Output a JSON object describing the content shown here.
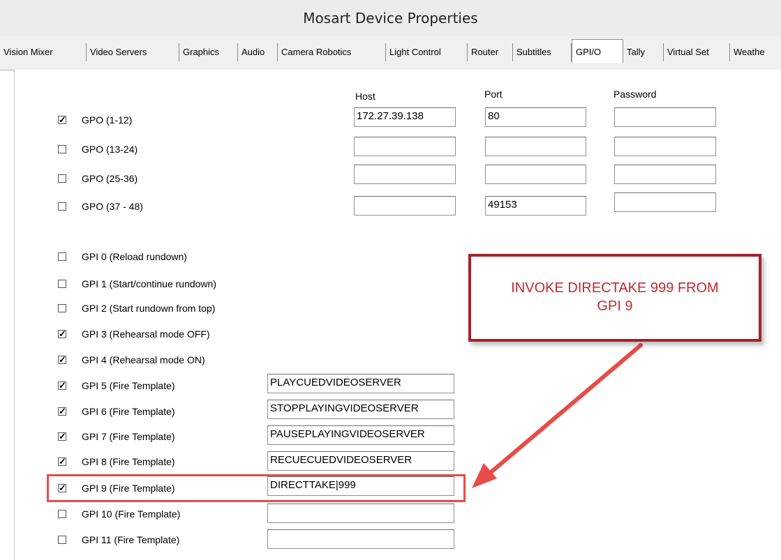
{
  "window": {
    "title": "Mosart Device Properties"
  },
  "tabs": [
    {
      "label": "Vision Mixer"
    },
    {
      "label": "Video Servers"
    },
    {
      "label": "Graphics"
    },
    {
      "label": "Audio"
    },
    {
      "label": "Camera Robotics"
    },
    {
      "label": "Light Control"
    },
    {
      "label": "Router"
    },
    {
      "label": "Subtitles"
    },
    {
      "label": "GPI/O",
      "active": true
    },
    {
      "label": "Tally"
    },
    {
      "label": "Virtual Set"
    },
    {
      "label": "Weathe"
    }
  ],
  "gpo": {
    "headers": {
      "host": "Host",
      "port": "Port",
      "password": "Password"
    },
    "rows": [
      {
        "label": "GPO (1-12)",
        "checked": true,
        "check_glyph": "✓",
        "host": "172.27.39.138",
        "port": "80",
        "password": ""
      },
      {
        "label": "GPO (13-24)",
        "checked": false,
        "check_glyph": "",
        "host": "",
        "port": "",
        "password": ""
      },
      {
        "label": "GPO (25-36)",
        "checked": false,
        "check_glyph": "",
        "host": "",
        "port": "",
        "password": ""
      },
      {
        "label": "GPO (37 - 48)",
        "checked": false,
        "check_glyph": "",
        "host": "",
        "port": "49153",
        "password": ""
      }
    ]
  },
  "gpi": {
    "rows": [
      {
        "label": "GPI 0  (Reload rundown)",
        "checked": false,
        "check_glyph": ""
      },
      {
        "label": "GPI 1  (Start/continue rundown)",
        "checked": false,
        "check_glyph": ""
      },
      {
        "label": "GPI 2  (Start rundown from top)",
        "checked": false,
        "check_glyph": ""
      },
      {
        "label": "GPI 3  (Rehearsal mode OFF)",
        "checked": true,
        "check_glyph": "✓"
      },
      {
        "label": "GPI 4  (Rehearsal mode ON)",
        "checked": true,
        "check_glyph": "✓"
      },
      {
        "label": "GPI 5 (Fire Template)",
        "checked": true,
        "check_glyph": "✓",
        "template": "PLAYCUEDVIDEOSERVER"
      },
      {
        "label": "GPI 6 (Fire Template)",
        "checked": true,
        "check_glyph": "✓",
        "template": "STOPPLAYINGVIDEOSERVER"
      },
      {
        "label": "GPI 7 (Fire Template)",
        "checked": true,
        "check_glyph": "✓",
        "template": "PAUSEPLAYINGVIDEOSERVER"
      },
      {
        "label": "GPI 8 (Fire Template)",
        "checked": true,
        "check_glyph": "✓",
        "template": "RECUECUEDVIDEOSERVER"
      },
      {
        "label": "GPI 9 (Fire Template)",
        "checked": true,
        "check_glyph": "✓",
        "template": "DIRECTTAKE|999"
      },
      {
        "label": "GPI 10 (Fire Template)",
        "checked": false,
        "check_glyph": "",
        "template": ""
      },
      {
        "label": "GPI 11 (Fire Template)",
        "checked": false,
        "check_glyph": "",
        "template": ""
      }
    ]
  },
  "callout": {
    "line1": "INVOKE DIRECTAKE 999 FROM",
    "line2": "GPI 9",
    "border_color": "#a1242a",
    "text_color": "#c5292f"
  },
  "highlight": {
    "color": "#e74c47"
  }
}
